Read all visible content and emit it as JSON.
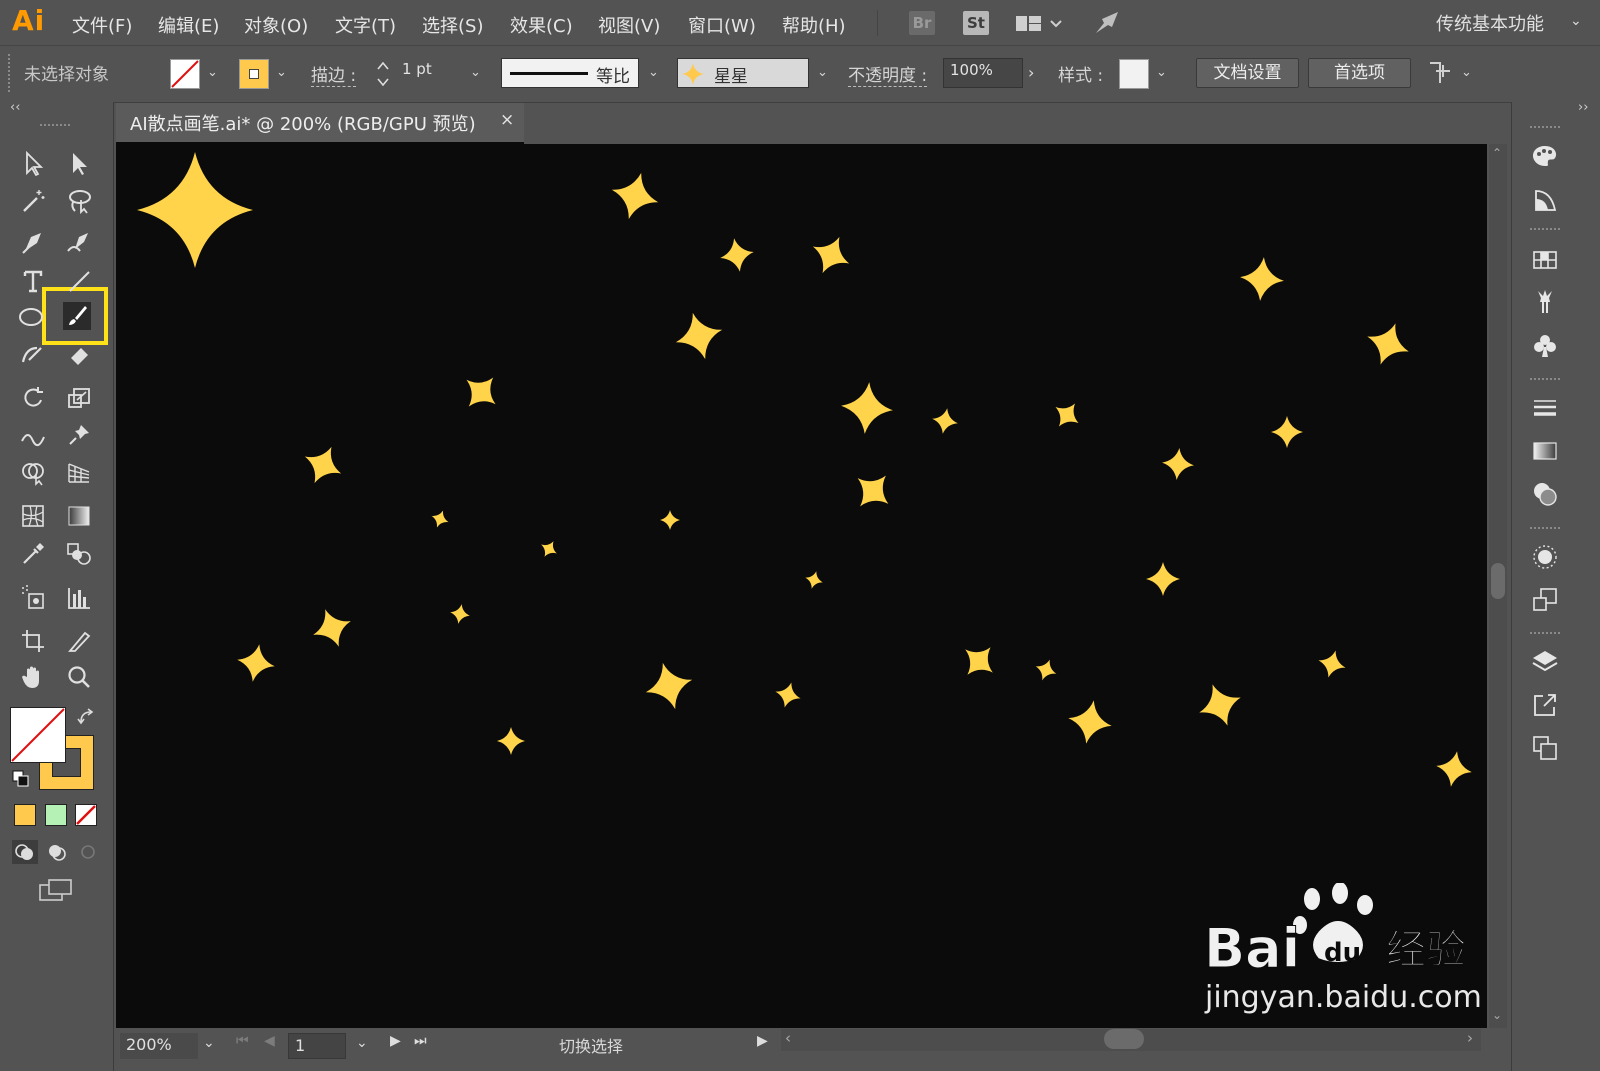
{
  "app": {
    "logo": "Ai",
    "menu": [
      "文件(F)",
      "编辑(E)",
      "对象(O)",
      "文字(T)",
      "选择(S)",
      "效果(C)",
      "视图(V)",
      "窗口(W)",
      "帮助(H)"
    ],
    "bridge_label": "Br",
    "stock_label": "St",
    "workspace": "传统基本功能"
  },
  "control": {
    "selection_status": "未选择对象",
    "stroke_label": "描边 :",
    "stroke_weight": "1 pt",
    "stroke_profile": "等比",
    "brush_name": "星星",
    "opacity_label": "不透明度 :",
    "opacity_value": "100%",
    "style_label": "样式 :",
    "doc_setup_button": "文档设置",
    "preferences_button": "首选项"
  },
  "document": {
    "tab_title": "AI散点画笔.ai* @ 200% (RGB/GPU 预览)",
    "close_glyph": "×"
  },
  "status": {
    "zoom": "200%",
    "artboard": "1",
    "tool_hint": "切换选择"
  },
  "colors": {
    "star_fill": "#ffd44a",
    "fill_swatch": "#ffc94d",
    "highlight": "#ffe11a",
    "canvas": "#0b0b0b"
  },
  "watermark": {
    "brand": "Bai 经验",
    "url": "jingyan.baidu.com"
  }
}
